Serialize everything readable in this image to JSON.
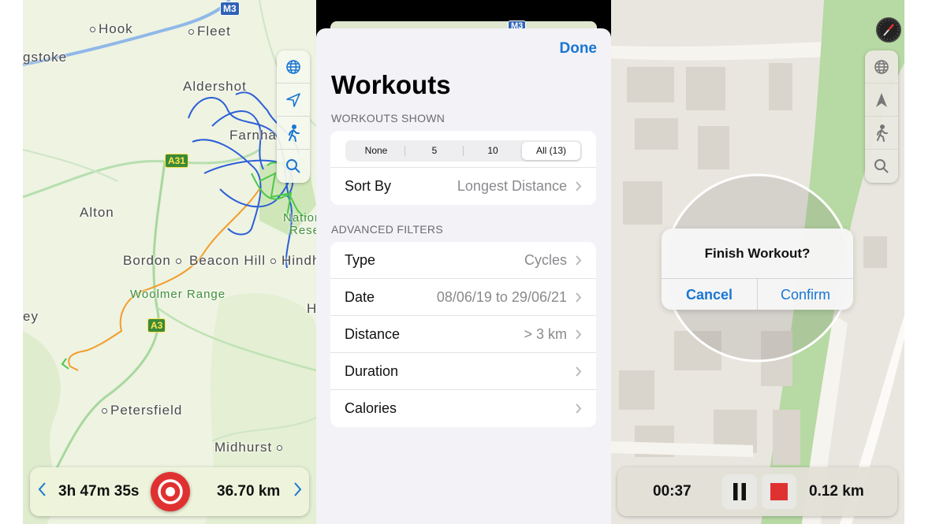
{
  "colors": {
    "accent": "#1a76d2",
    "record_red": "#e03131",
    "route_blue": "#2c5fd6",
    "route_orange": "#f39c2b",
    "route_green": "#4cc84a"
  },
  "map1": {
    "places": {
      "hook": "Hook",
      "fleet": "Fleet",
      "stoke": "gstoke",
      "aldershot": "Aldershot",
      "farnham": "Farnha",
      "alton": "Alton",
      "bordon": "Bordon",
      "beacon_hill": "Beacon Hill",
      "hindhead": "Hindh",
      "woolmer": "Woolmer Range",
      "petersfield": "Petersfield",
      "midhurst": "Midhurst",
      "ey": "ey",
      "h": "H",
      "national_a": "National",
      "reserve": "Rese"
    },
    "shields": {
      "m3": "M3",
      "a31": "A31",
      "a3": "A3"
    },
    "controls": [
      "globe-icon",
      "location-arrow-icon",
      "walking-icon",
      "search-icon"
    ],
    "bottom": {
      "duration": "3h 47m 35s",
      "distance": "36.70 km",
      "prev": "<",
      "next": ">"
    }
  },
  "workouts": {
    "done": "Done",
    "title": "Workouts",
    "shown_header": "WORKOUTS SHOWN",
    "segments": [
      "None",
      "5",
      "10",
      "All (13)"
    ],
    "selected_segment": 3,
    "sort_label": "Sort By",
    "sort_value": "Longest Distance",
    "advanced_header": "ADVANCED FILTERS",
    "filters": [
      {
        "label": "Type",
        "value": "Cycles"
      },
      {
        "label": "Date",
        "value": "08/06/19 to 29/06/21"
      },
      {
        "label": "Distance",
        "value": "> 3 km"
      },
      {
        "label": "Duration",
        "value": ""
      },
      {
        "label": "Calories",
        "value": ""
      }
    ],
    "peek_shield": "M3"
  },
  "map3": {
    "alert": {
      "title": "Finish Workout?",
      "cancel": "Cancel",
      "confirm": "Confirm"
    },
    "controls": [
      "globe-icon",
      "north-arrow-icon",
      "walking-icon",
      "search-icon"
    ],
    "bottom": {
      "time": "00:37",
      "distance": "0.12 km"
    }
  }
}
